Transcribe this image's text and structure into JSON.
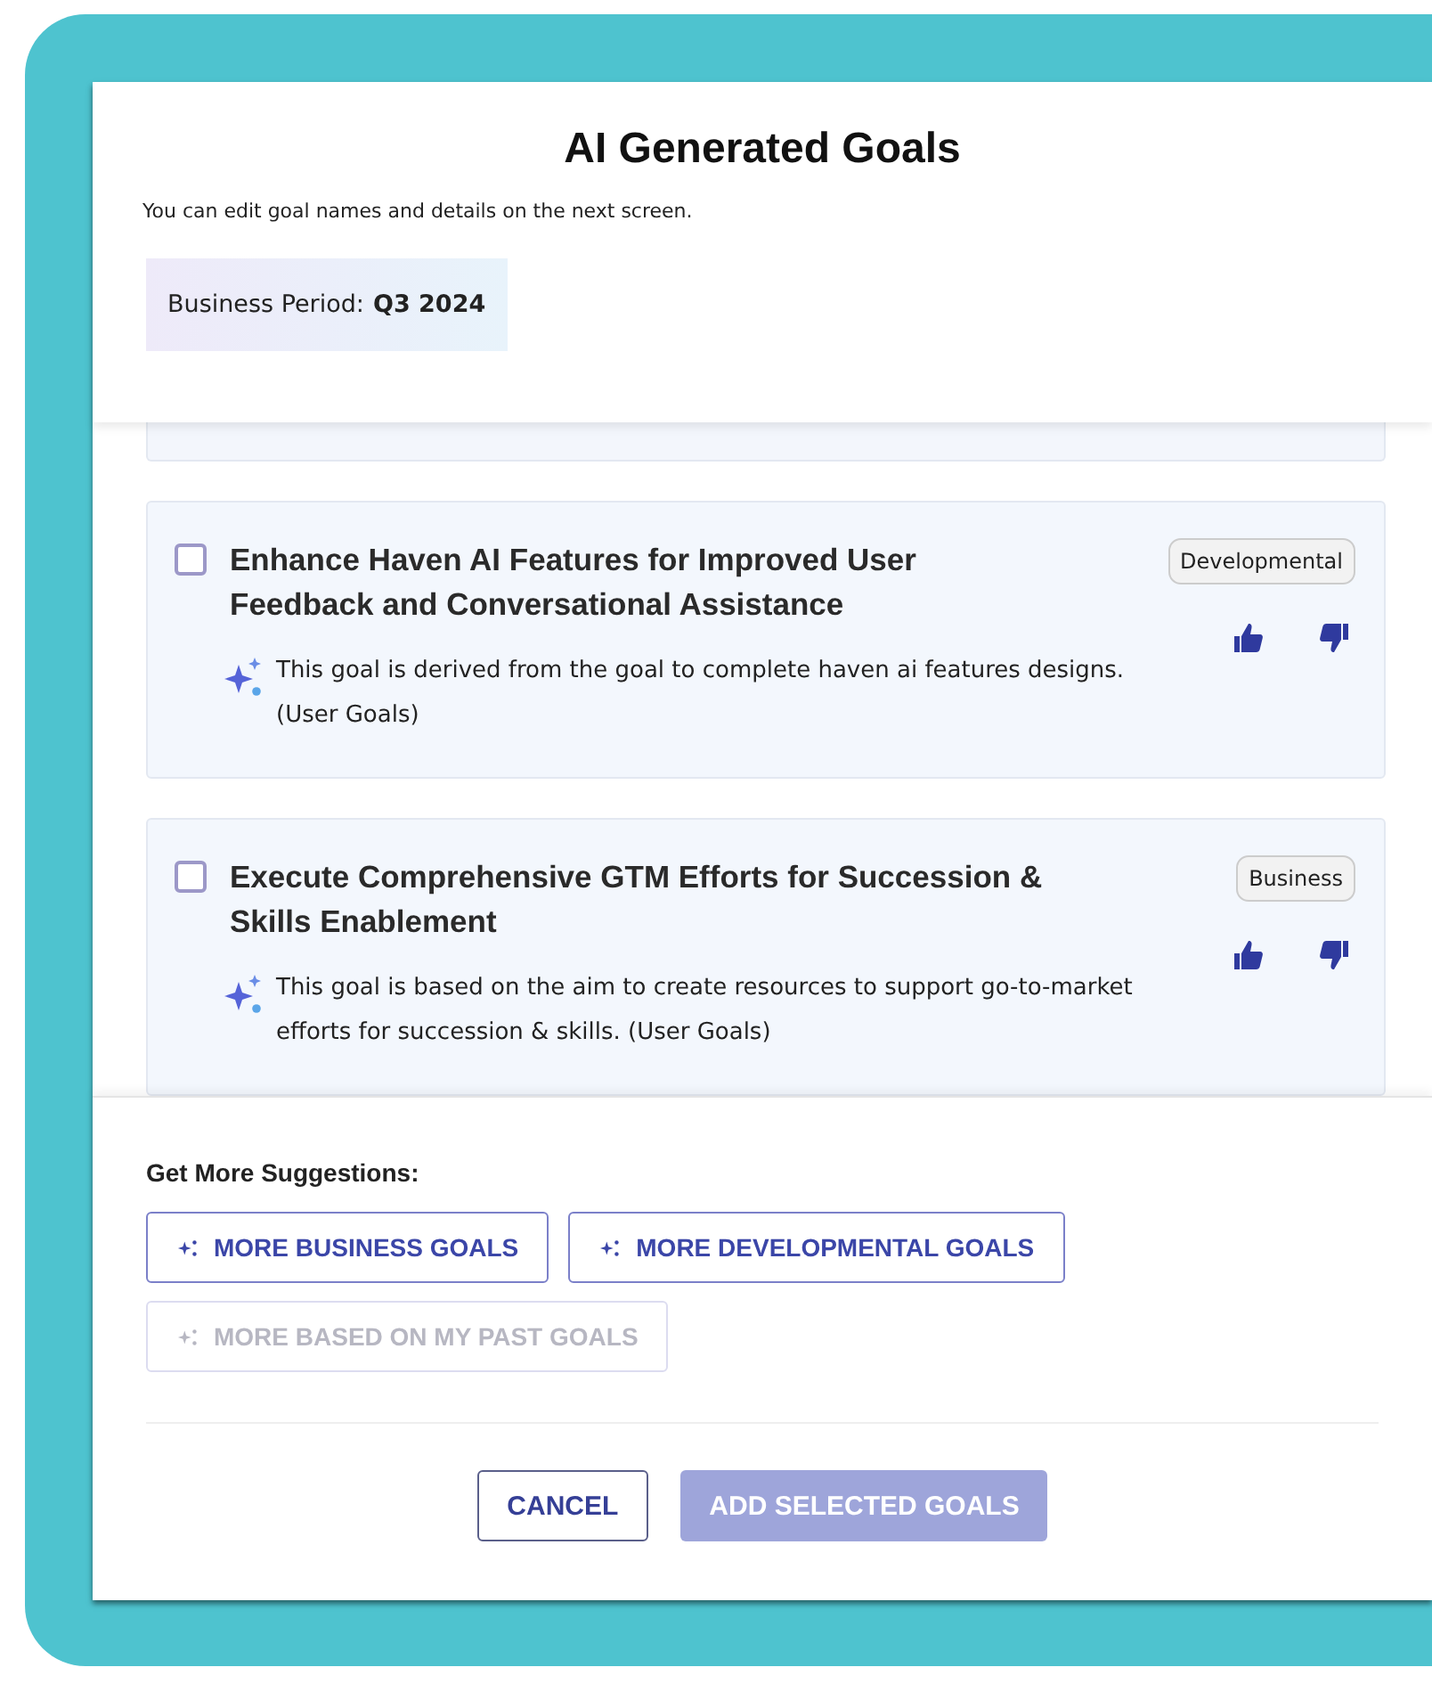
{
  "dialog": {
    "title": "AI Generated Goals",
    "subtitle": "You can edit goal names and details on the next screen.",
    "period": {
      "label": "Business Period:",
      "value": "Q3 2024"
    }
  },
  "goals": [
    {
      "title": "Enhance Haven AI Features for Improved User Feedback and Conversational Assistance",
      "description": "This goal is derived from the goal to complete haven ai features designs. (User Goals)",
      "tag": "Developmental",
      "checked": false
    },
    {
      "title": "Execute Comprehensive GTM Efforts for Succession & Skills Enablement",
      "description": "This goal is based on the aim to create resources to support go-to-market efforts for succession & skills. (User Goals)",
      "tag": "Business",
      "checked": false
    }
  ],
  "suggestions": {
    "heading": "Get More Suggestions:",
    "buttons": [
      {
        "label": "MORE BUSINESS GOALS",
        "disabled": false
      },
      {
        "label": "MORE DEVELOPMENTAL GOALS",
        "disabled": false
      },
      {
        "label": "MORE BASED ON MY PAST GOALS",
        "disabled": true
      }
    ]
  },
  "actions": [
    {
      "label": "CANCEL",
      "kind": "secondary",
      "disabled": false
    },
    {
      "label": "ADD SELECTED GOALS",
      "kind": "primary",
      "disabled": true
    }
  ]
}
